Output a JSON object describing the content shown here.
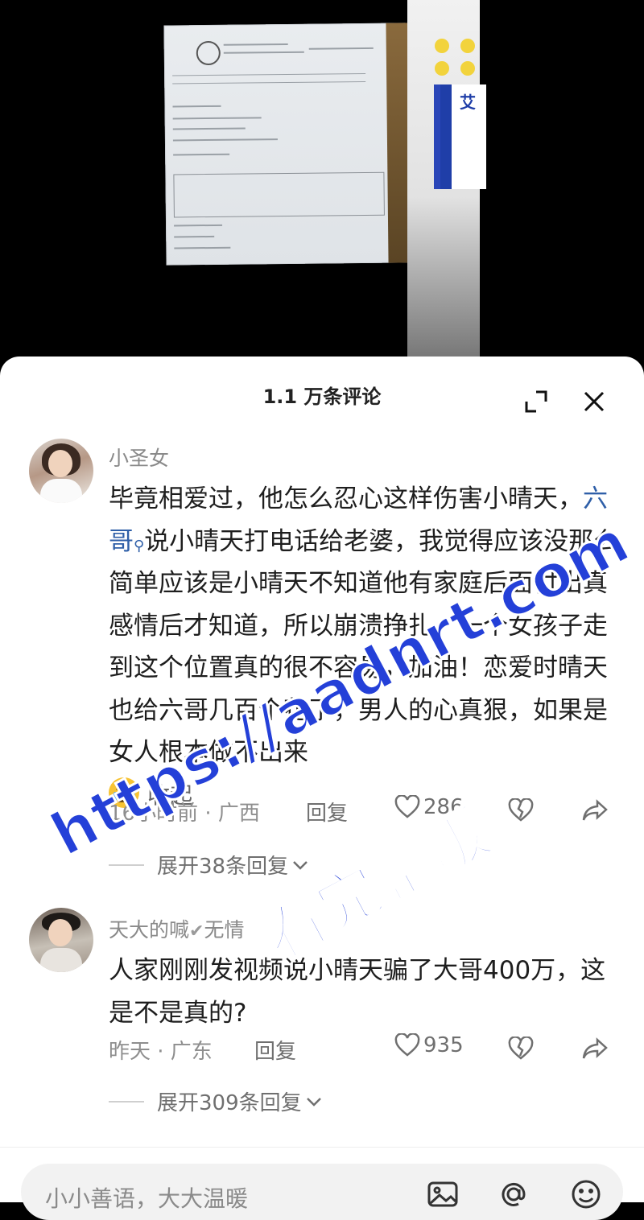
{
  "sheet": {
    "title": "1.1 万条评论",
    "expand_icon": "expand-icon",
    "close_icon": "close-icon"
  },
  "comments": [
    {
      "username": "小圣女",
      "text_before": "毕竟相爱过，他怎么忍心这样伤害小晴天，",
      "mention": "六哥",
      "text_after": "说小晴天打电话给老婆，我觉得应该没那么简单应该是小晴天不知道他有家庭后面付出真感情后才知道，所以崩溃挣扎，一个女孩子走到这个位置真的很不容易，加油！恋爱时晴天也给六哥几百个花了，男人的心真狠，如果是女人根本做不出来",
      "collapse_label": "收起",
      "meta": "16小时前 · 广西",
      "reply_label": "回复",
      "likes": "286",
      "expand_replies": "展开38条回复"
    },
    {
      "username": "天大的喊",
      "username_suffix": "无情",
      "text": "人家刚刚发视频说小晴天骗了大哥400万，这是不是真的?",
      "meta": "昨天 · 广东",
      "reply_label": "回复",
      "likes": "935",
      "expand_replies": "展开309条回复"
    }
  ],
  "input": {
    "placeholder": "小小善语，大大温暖"
  },
  "watermark": {
    "url": "https://aadnrt.com",
    "subtitle": "看完整版"
  },
  "colors": {
    "mention": "#2f5fa8",
    "watermark": "#2440d8"
  }
}
